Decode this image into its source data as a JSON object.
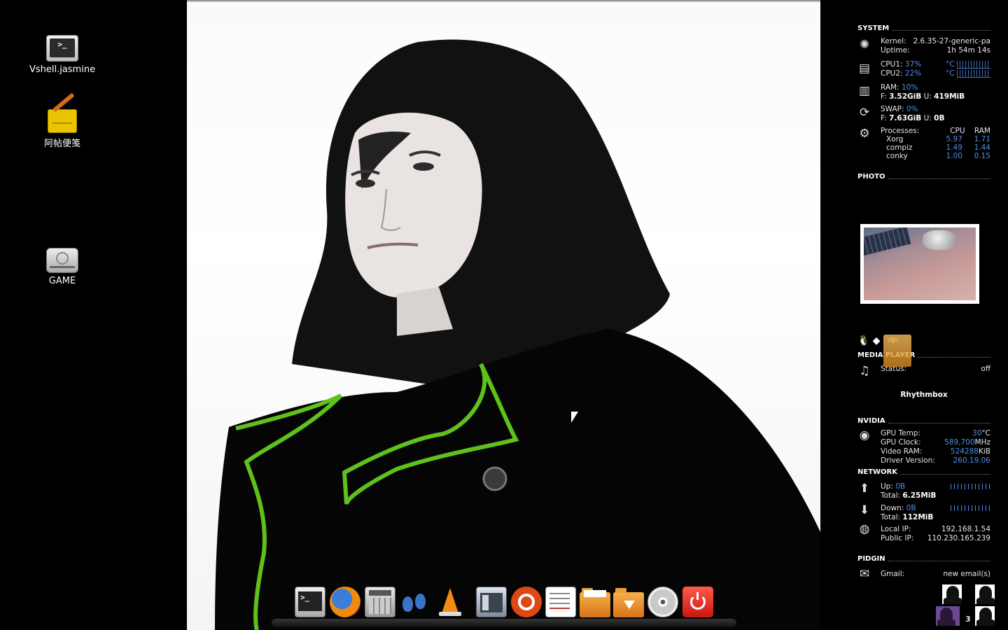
{
  "desktop": {
    "icons": [
      {
        "label": "Vshell.jasmine"
      },
      {
        "label": "阿帖便笺"
      },
      {
        "label": "GAME"
      }
    ]
  },
  "dock": {
    "items": [
      "terminal-icon",
      "firefox-icon",
      "calculator-icon",
      "gnome-foot-icon",
      "vlc-icon",
      "window-manager-icon",
      "ubuntu-icon",
      "text-editor-icon",
      "folder-icon",
      "downloads-folder-icon",
      "cd-icon",
      "power-icon"
    ]
  },
  "conky": {
    "system": {
      "title": "SYSTEM",
      "kernel_label": "Kernel:",
      "kernel_value": "2.6.35-27-generic-pa",
      "uptime_label": "Uptime:",
      "uptime_value": "1h 54m 14s",
      "cpu1_label": "CPU1:",
      "cpu1_value": "37%",
      "cpu1_temp": "°C",
      "cpu2_label": "CPU2:",
      "cpu2_value": "22%",
      "cpu2_temp": "°C",
      "ram_label": "RAM:",
      "ram_value": "10%",
      "ram_free_label": "F:",
      "ram_free": "3.52GiB",
      "ram_used_label": "U:",
      "ram_used": "419MiB",
      "swap_label": "SWAP:",
      "swap_value": "0%",
      "swap_free_label": "F:",
      "swap_free": "7.63GiB",
      "swap_used_label": "U:",
      "swap_used": "0B",
      "processes_label": "Processes:",
      "cpu_col": "CPU",
      "ram_col": "RAM",
      "processes": [
        {
          "name": "Xorg",
          "cpu": "5.97",
          "ram": "1.71"
        },
        {
          "name": "compiz",
          "cpu": "1.49",
          "ram": "1.44"
        },
        {
          "name": "conky",
          "cpu": "1.00",
          "ram": "0.15"
        }
      ]
    },
    "photo": {
      "title": "PHOTO"
    },
    "media": {
      "title": "MEDIA PLAYER",
      "status_label": "Status:",
      "status_value": "off",
      "player": "Rhythmbox"
    },
    "nvidia": {
      "title": "NVIDIA",
      "gpu_temp_label": "GPU Temp:",
      "gpu_temp": "30",
      "gpu_temp_unit": "°C",
      "gpu_clock_label": "GPU Clock:",
      "gpu_clock": "589,700",
      "gpu_clock_unit": "MHz",
      "vram_label": "Video RAM:",
      "vram": "524288",
      "vram_unit": "KiB",
      "driver_label": "Driver Version:",
      "driver": "260.19.06"
    },
    "network": {
      "title": "NETWORK",
      "up_label": "Up:",
      "up_value": "0B",
      "up_total_label": "Total:",
      "up_total": "6.25MiB",
      "down_label": "Down:",
      "down_value": "0B",
      "down_total_label": "Total:",
      "down_total": "112MiB",
      "local_ip_label": "Local IP:",
      "local_ip": "192.168.1.54",
      "public_ip_label": "Public IP:",
      "public_ip": "110.230.165.239"
    },
    "pidgin": {
      "title": "PIDGIN",
      "gmail_label": "Gmail:",
      "gmail_value": "new email(s)",
      "badge_count": "3"
    }
  },
  "colors": {
    "accent_blue": "#4f8fe8",
    "background": "#000000",
    "coat_trim": "#5fc11c"
  }
}
